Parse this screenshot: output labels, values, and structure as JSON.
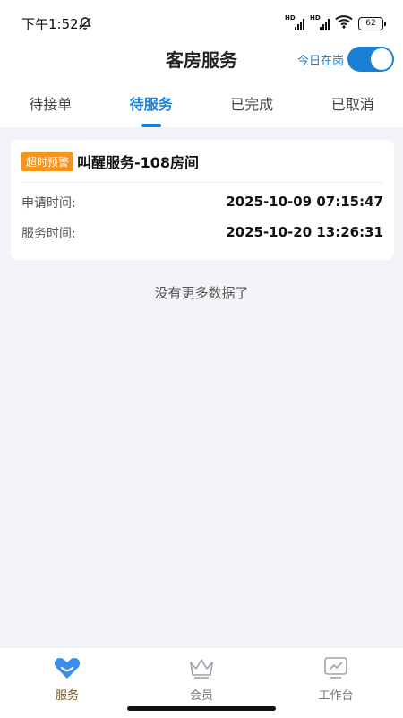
{
  "status_bar": {
    "time": "下午1:52",
    "battery": "62"
  },
  "header": {
    "title": "客房服务",
    "duty_label": "今日在岗",
    "duty_on": true
  },
  "tabs": [
    {
      "label": "待接单",
      "active": false
    },
    {
      "label": "待服务",
      "active": true
    },
    {
      "label": "已完成",
      "active": false
    },
    {
      "label": "已取消",
      "active": false
    }
  ],
  "orders": [
    {
      "badge": "超时预警",
      "title": "叫醒服务-108房间",
      "apply_label": "申请时间:",
      "apply_time": "2025-10-09 07:15:47",
      "service_label": "服务时间:",
      "service_time": "2025-10-20 13:26:31"
    }
  ],
  "list_footer": "没有更多数据了",
  "bottom_nav": [
    {
      "label": "服务",
      "icon": "service-heart-icon",
      "active": true
    },
    {
      "label": "会员",
      "icon": "crown-icon",
      "active": false
    },
    {
      "label": "工作台",
      "icon": "chart-board-icon",
      "active": false
    }
  ],
  "colors": {
    "primary": "#1a7fd6",
    "warning_badge": "#f5941f",
    "nav_active": "#6b5a23"
  }
}
